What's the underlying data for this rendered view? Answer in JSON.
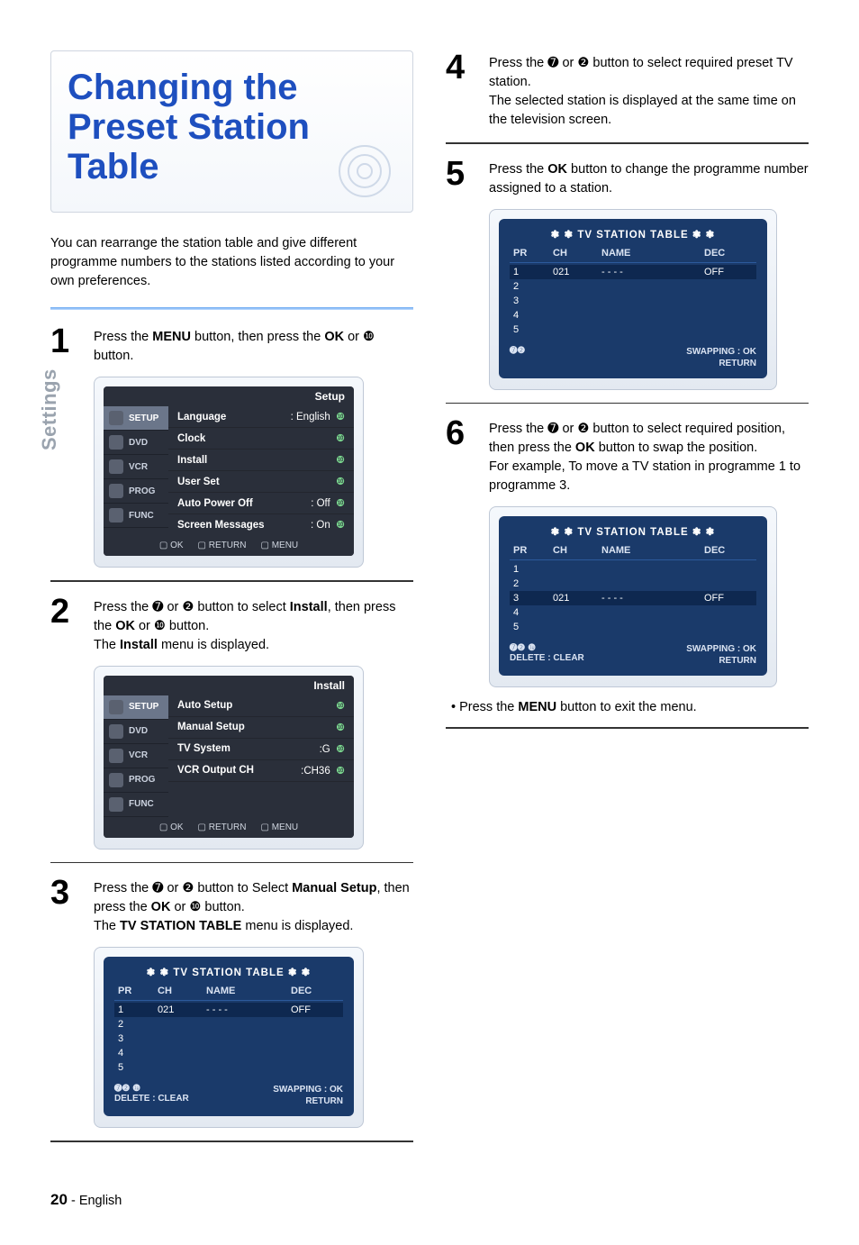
{
  "sidebar_label": "Settings",
  "page_title": "Changing the Preset Station Table",
  "intro": "You can rearrange the station table and give different programme numbers to the stations listed according to your own preferences.",
  "step1": {
    "pre": "Press the ",
    "menu": "MENU",
    "mid": " button, then press the ",
    "ok": "OK",
    "post": " or ❿ button."
  },
  "osd_setup": {
    "title": "Setup",
    "tabs": [
      "SETUP",
      "DVD",
      "VCR",
      "PROG",
      "FUNC"
    ],
    "rows": [
      {
        "label": "Language",
        "value": ": English"
      },
      {
        "label": "Clock",
        "value": ""
      },
      {
        "label": "Install",
        "value": ""
      },
      {
        "label": "User Set",
        "value": ""
      },
      {
        "label": "Auto Power Off",
        "value": ": Off"
      },
      {
        "label": "Screen Messages",
        "value": ": On"
      }
    ],
    "foot": [
      "OK",
      "RETURN",
      "MENU"
    ]
  },
  "step2": {
    "text_pre": "Press the ➐ or ❷ button to select ",
    "install": "Install",
    "text_mid": ", then press the ",
    "ok": "OK",
    "text_mid2": " or ❿ button.",
    "line2_pre": "The ",
    "line2_b": "Install",
    "line2_post": " menu is displayed."
  },
  "osd_install": {
    "title": "Install",
    "tabs": [
      "SETUP",
      "DVD",
      "VCR",
      "PROG",
      "FUNC"
    ],
    "rows": [
      {
        "label": "Auto Setup",
        "value": ""
      },
      {
        "label": "Manual Setup",
        "value": ""
      },
      {
        "label": "TV System",
        "value": ":G"
      },
      {
        "label": "VCR Output CH",
        "value": ":CH36"
      }
    ],
    "foot": [
      "OK",
      "RETURN",
      "MENU"
    ]
  },
  "step3": {
    "pre": "Press the ➐ or ❷ button to Select ",
    "manual": "Manual Setup",
    "mid": ", then press the ",
    "ok": "OK",
    "mid2": " or ❿ button.",
    "line2_pre": "The ",
    "line2_b": "TV STATION TABLE",
    "line2_post": " menu is displayed."
  },
  "table_common": {
    "title_pre": "❃ ❃   ",
    "title": "TV  STATION  TABLE",
    "title_post": "   ❃ ❃",
    "head": [
      "PR",
      "CH",
      "NAME",
      "DEC"
    ],
    "swapping": "SWAPPING : OK",
    "return": "RETURN",
    "delete": "DELETE : CLEAR",
    "arrows_ud": "➐❷",
    "arrows_udr": "➐❷  ❿"
  },
  "table1": {
    "rows": [
      {
        "pr": "1",
        "ch": "021",
        "name": "- - - -",
        "dec": "OFF",
        "hi": true
      },
      {
        "pr": "2",
        "ch": "",
        "name": "",
        "dec": ""
      },
      {
        "pr": "3",
        "ch": "",
        "name": "",
        "dec": ""
      },
      {
        "pr": "4",
        "ch": "",
        "name": "",
        "dec": ""
      },
      {
        "pr": "5",
        "ch": "",
        "name": "",
        "dec": ""
      }
    ],
    "foot_left": "arrows_udr",
    "show_delete": true
  },
  "step4": {
    "line1": "Press the ➐ or ❷ button to select required preset TV station.",
    "line2": "The selected station is displayed at the same time on the television screen."
  },
  "step5": {
    "pre": "Press the ",
    "ok": "OK",
    "post": " button to change the programme number assigned to a station."
  },
  "table2": {
    "rows": [
      {
        "pr": "1",
        "ch": "021",
        "name": "- - - -",
        "dec": "OFF",
        "hi": true
      },
      {
        "pr": "2",
        "ch": "",
        "name": "",
        "dec": ""
      },
      {
        "pr": "3",
        "ch": "",
        "name": "",
        "dec": ""
      },
      {
        "pr": "4",
        "ch": "",
        "name": "",
        "dec": ""
      },
      {
        "pr": "5",
        "ch": "",
        "name": "",
        "dec": ""
      }
    ],
    "foot_left": "arrows_ud",
    "show_delete": false
  },
  "step6": {
    "line1_pre": "Press the ➐ or ❷ button to select required position, then press the ",
    "ok": "OK",
    "line1_post": " button to swap the position.",
    "line2": "For example, To move a TV station in programme 1 to programme 3."
  },
  "table3": {
    "rows": [
      {
        "pr": "1",
        "ch": "",
        "name": "",
        "dec": ""
      },
      {
        "pr": "2",
        "ch": "",
        "name": "",
        "dec": ""
      },
      {
        "pr": "3",
        "ch": "021",
        "name": "- - - -",
        "dec": "OFF",
        "hi": true
      },
      {
        "pr": "4",
        "ch": "",
        "name": "",
        "dec": ""
      },
      {
        "pr": "5",
        "ch": "",
        "name": "",
        "dec": ""
      }
    ],
    "foot_left": "arrows_udr",
    "show_delete": true
  },
  "exit_note": {
    "pre": "• Press the ",
    "menu": "MENU",
    "post": " button to exit the menu."
  },
  "page_number": "20",
  "page_lang": "English",
  "dash": " - "
}
